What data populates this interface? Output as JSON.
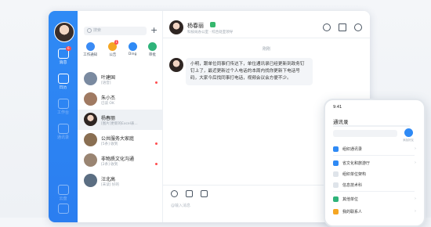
{
  "window": {
    "controls": [
      "—",
      "□",
      "×"
    ]
  },
  "rail": {
    "items": [
      {
        "label": "消息",
        "badge": "6"
      },
      {
        "label": "日历",
        "badge": ""
      },
      {
        "label": "工作台",
        "badge": ""
      },
      {
        "label": "通讯录",
        "badge": ""
      },
      {
        "label": "云盘",
        "badge": ""
      },
      {
        "label": "",
        "badge": ""
      }
    ]
  },
  "list": {
    "search_placeholder": "搜索",
    "add_label": "+",
    "quick": [
      {
        "label": "工作通知",
        "badge": "",
        "color": "#3a8bf5"
      },
      {
        "label": "公告",
        "badge": "1",
        "color": "#f5a623"
      },
      {
        "label": "Ding",
        "badge": "",
        "color": "#2f8af5"
      },
      {
        "label": "审批",
        "badge": "",
        "color": "#2fb37a"
      }
    ],
    "chats": [
      {
        "name": "叶建国",
        "sub": "[语音]",
        "dot": true,
        "avatar_color": "#7a8aa0"
      },
      {
        "name": "朱小杰",
        "sub": "已读 OK",
        "dot": false,
        "avatar_color": "#a07a62"
      },
      {
        "name": "杨春丽",
        "sub": "[图片]更新的Excel表...",
        "dot": false,
        "avatar_color": "#3a2e2a"
      },
      {
        "name": "公共服务大家庭",
        "sub": "[5条] 收到",
        "dot": true,
        "avatar_color": "#8a6f52"
      },
      {
        "name": "非物质文化沟通",
        "sub": "[2条] 收到",
        "dot": true,
        "avatar_color": "#9a8572"
      },
      {
        "name": "汪北高",
        "sub": "[未读] 好的",
        "dot": false,
        "avatar_color": "#5b6e82"
      }
    ]
  },
  "chat": {
    "name": "杨春丽",
    "subtitle": "科技局办公室 · 综合处室领导",
    "time": "刚刚",
    "message": "小明，跟单位同事们传达下，单位通讯录已经更新到政务钉钉上了，最近更新过个人电话的本周内找你更新下电话号码，大家今后找同事打电话，视频会议会方便不少。",
    "composer_placeholder": "@输入消息"
  },
  "phone": {
    "time": "9:41",
    "title": "通讯录",
    "add_label": "添加好友",
    "rows": [
      {
        "label": "组织通讯录",
        "color": "#2f8af5",
        "arrow": "›"
      },
      {
        "label": "省文化和旅游厅",
        "color": "#2f8af5",
        "arrow": "›"
      },
      {
        "label": "组织单位架构",
        "color": "#dfe4ea",
        "arrow": ""
      },
      {
        "label": "信息技术科",
        "color": "#dfe4ea",
        "arrow": ""
      },
      {
        "label": "其他单位",
        "color": "#2fb37a",
        "arrow": "›"
      },
      {
        "label": "我的联系人",
        "color": "#f5a623",
        "arrow": "›"
      }
    ]
  },
  "colors": {
    "accent": "#2f8af5",
    "badge": "#ff4d4f"
  }
}
